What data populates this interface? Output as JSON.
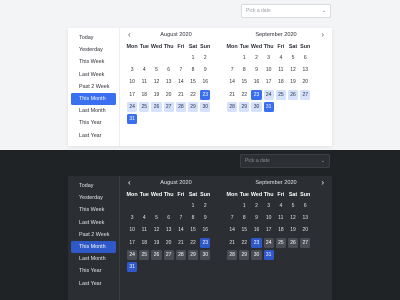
{
  "picker": {
    "placeholder": "Pick a date"
  },
  "shortcuts": [
    "Today",
    "Yesterday",
    "This Week",
    "Last Week",
    "Past 2 Week",
    "This Month",
    "Last Month",
    "This Year",
    "Last Year"
  ],
  "active_shortcut": "This Month",
  "weekdays": [
    "Mon",
    "Tue",
    "Wed",
    "Thu",
    "Fri",
    "Sat",
    "Sun"
  ],
  "months": [
    {
      "title": "August 2020",
      "weeks": [
        [
          "",
          "",
          "",
          "",
          "",
          "1",
          "2"
        ],
        [
          "3",
          "4",
          "5",
          "6",
          "7",
          "8",
          "9"
        ],
        [
          "10",
          "11",
          "12",
          "13",
          "14",
          "15",
          "16"
        ],
        [
          "17",
          "18",
          "19",
          "20",
          "21",
          "22",
          "23"
        ],
        [
          "24",
          "25",
          "26",
          "27",
          "28",
          "29",
          "30"
        ],
        [
          "31",
          "",
          "",
          "",
          "",
          "",
          ""
        ]
      ]
    },
    {
      "title": "September 2020",
      "weeks": [
        [
          "",
          "1",
          "2",
          "3",
          "4",
          "5",
          "6"
        ],
        [
          "7",
          "8",
          "9",
          "10",
          "11",
          "12",
          "13"
        ],
        [
          "14",
          "15",
          "16",
          "17",
          "18",
          "19",
          "20"
        ],
        [
          "21",
          "22",
          "23",
          "24",
          "25",
          "26",
          "27"
        ],
        [
          "28",
          "29",
          "30",
          "31",
          "",
          "",
          ""
        ]
      ]
    }
  ],
  "range": {
    "start": "23",
    "end": "31"
  },
  "icons": {
    "prev": "chevron-left-icon",
    "next": "chevron-right-icon",
    "dropdown": "chevron-down-icon"
  }
}
